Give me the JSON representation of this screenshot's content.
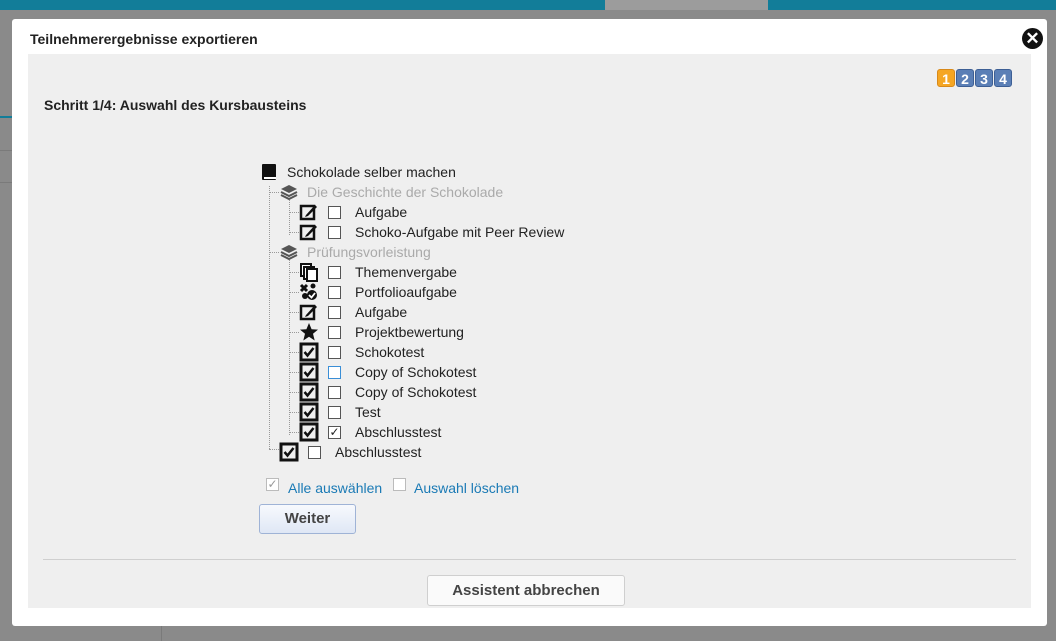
{
  "dialog": {
    "title": "Teilnehmerergebnisse exportieren",
    "step_title": "Schritt 1/4: Auswahl des Kursbausteins",
    "steps": [
      "1",
      "2",
      "3",
      "4"
    ],
    "active_step": 1
  },
  "tree": {
    "root": "Schokolade selber machen",
    "groups": [
      {
        "label": "Die Geschichte der Schokolade",
        "items": [
          {
            "label": "Aufgabe",
            "icon": "edit-icon",
            "checked": false
          },
          {
            "label": "Schoko-Aufgabe mit Peer Review",
            "icon": "edit-icon",
            "checked": false
          }
        ]
      },
      {
        "label": "Prüfungsvorleistung",
        "items": [
          {
            "label": "Themenvergabe",
            "icon": "copy-icon",
            "checked": false
          },
          {
            "label": "Portfolioaufgabe",
            "icon": "portfolio-icon",
            "checked": false
          },
          {
            "label": "Aufgabe",
            "icon": "edit-icon",
            "checked": false
          },
          {
            "label": "Projektbewertung",
            "icon": "star-icon",
            "checked": false
          },
          {
            "label": "Schokotest",
            "icon": "test-icon",
            "checked": false
          },
          {
            "label": "Copy of Schokotest",
            "icon": "test-icon",
            "checked": false,
            "focused": true
          },
          {
            "label": "Copy of Schokotest",
            "icon": "test-icon",
            "checked": false
          },
          {
            "label": "Test",
            "icon": "test-icon",
            "checked": false
          },
          {
            "label": "Abschlusstest",
            "icon": "test-icon",
            "checked": true
          }
        ]
      }
    ],
    "final_item": {
      "label": "Abschlusstest",
      "icon": "test-icon",
      "checked": false
    }
  },
  "actions": {
    "select_all": "Alle auswählen",
    "clear_selection": "Auswahl löschen",
    "next": "Weiter",
    "cancel": "Assistent abbrechen"
  },
  "colors": {
    "header_bar": "#127d99",
    "active_step": "#f5a623",
    "step": "#5b7fb6",
    "link": "#1a7ab5"
  }
}
